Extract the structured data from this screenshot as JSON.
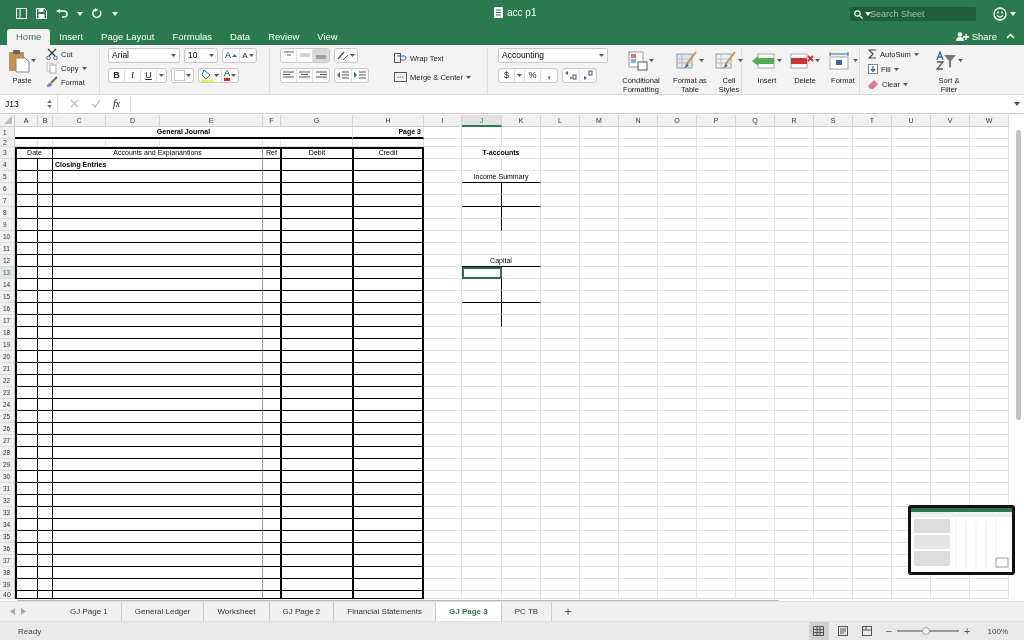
{
  "title_bar": {
    "title": "acc p1",
    "search": {
      "placeholder": "Search Sheet"
    }
  },
  "ribbon_tabs": [
    {
      "label": "Home",
      "selected": true
    },
    {
      "label": "Insert",
      "selected": false
    },
    {
      "label": "Page Layout",
      "selected": false
    },
    {
      "label": "Formulas",
      "selected": false
    },
    {
      "label": "Data",
      "selected": false
    },
    {
      "label": "Review",
      "selected": false
    },
    {
      "label": "View",
      "selected": false
    }
  ],
  "share": "Share",
  "ribbon": {
    "clipboard": {
      "paste": "Paste",
      "cut": "Cut",
      "copy": "Copy",
      "format": "Format"
    },
    "font": {
      "name": "Arial",
      "size": "10",
      "grow": "A",
      "shrink": "A",
      "bold": "B",
      "italic": "I",
      "underline": "U",
      "font_color": "A"
    },
    "alignment": {
      "wrap_text": "Wrap Text",
      "merge": "Merge & Center"
    },
    "number": {
      "format": "Accounting",
      "currency": "$",
      "percent": "%",
      "comma": ","
    },
    "styles": [
      "Conditional Formatting",
      "Format as Table",
      "Cell Styles"
    ],
    "cells": [
      "Insert",
      "Delete",
      "Format"
    ],
    "editing": {
      "autosum": "AutoSum",
      "fill": "Fill",
      "clear": "Clear",
      "sort": "Sort & Filter"
    }
  },
  "formula_bar": {
    "name_box": "J13",
    "fx": "fx"
  },
  "sheet": {
    "columns": [
      {
        "label": "A",
        "selected": false
      },
      {
        "label": "B",
        "selected": false
      },
      {
        "label": "C",
        "selected": false
      },
      {
        "label": "D",
        "selected": false
      },
      {
        "label": "E",
        "selected": false
      },
      {
        "label": "F",
        "selected": false
      },
      {
        "label": "G",
        "selected": false
      },
      {
        "label": "H",
        "selected": false
      },
      {
        "label": "I",
        "selected": false
      },
      {
        "label": "J",
        "selected": true
      },
      {
        "label": "K",
        "selected": false
      },
      {
        "label": "L",
        "selected": false
      },
      {
        "label": "M",
        "selected": false
      },
      {
        "label": "N",
        "selected": false
      },
      {
        "label": "O",
        "selected": false
      },
      {
        "label": "P",
        "selected": false
      },
      {
        "label": "Q",
        "selected": false
      },
      {
        "label": "R",
        "selected": false
      },
      {
        "label": "S",
        "selected": false
      },
      {
        "label": "T",
        "selected": false
      },
      {
        "label": "U",
        "selected": false
      },
      {
        "label": "V",
        "selected": false
      },
      {
        "label": "W",
        "selected": false
      }
    ],
    "rows": [
      {
        "label": "1",
        "selected": false
      },
      {
        "label": "2",
        "selected": false
      },
      {
        "label": "3",
        "selected": false
      },
      {
        "label": "4",
        "selected": false
      },
      {
        "label": "5",
        "selected": false
      },
      {
        "label": "6",
        "selected": false
      },
      {
        "label": "7",
        "selected": false
      },
      {
        "label": "8",
        "selected": false
      },
      {
        "label": "9",
        "selected": false
      },
      {
        "label": "10",
        "selected": false
      },
      {
        "label": "11",
        "selected": false
      },
      {
        "label": "12",
        "selected": false
      },
      {
        "label": "13",
        "selected": true
      },
      {
        "label": "14",
        "selected": false
      },
      {
        "label": "15",
        "selected": false
      },
      {
        "label": "16",
        "selected": false
      },
      {
        "label": "17",
        "selected": false
      },
      {
        "label": "18",
        "selected": false
      },
      {
        "label": "19",
        "selected": false
      },
      {
        "label": "20",
        "selected": false
      },
      {
        "label": "21",
        "selected": false
      },
      {
        "label": "22",
        "selected": false
      },
      {
        "label": "23",
        "selected": false
      },
      {
        "label": "24",
        "selected": false
      },
      {
        "label": "25",
        "selected": false
      },
      {
        "label": "26",
        "selected": false
      },
      {
        "label": "27",
        "selected": false
      },
      {
        "label": "28",
        "selected": false
      },
      {
        "label": "29",
        "selected": false
      },
      {
        "label": "30",
        "selected": false
      },
      {
        "label": "31",
        "selected": false
      },
      {
        "label": "32",
        "selected": false
      },
      {
        "label": "33",
        "selected": false
      },
      {
        "label": "34",
        "selected": false
      },
      {
        "label": "35",
        "selected": false
      },
      {
        "label": "36",
        "selected": false
      },
      {
        "label": "37",
        "selected": false
      },
      {
        "label": "38",
        "selected": false
      },
      {
        "label": "39",
        "selected": false
      },
      {
        "label": "40",
        "selected": false
      }
    ],
    "journal": {
      "title": "General Journal",
      "page": "Page 3",
      "headers": [
        "Date",
        "Accounts and Explanantions",
        "Ref",
        "Debit",
        "Credit"
      ],
      "entries": [
        "Closing Entries"
      ]
    },
    "t_accounts": {
      "title": "T-accounts",
      "accounts": [
        {
          "name": "Income Summary"
        },
        {
          "name": "Capital"
        }
      ]
    }
  },
  "sheet_tabs": [
    {
      "label": "GJ Page 1",
      "selected": false
    },
    {
      "label": "General Ledger",
      "selected": false
    },
    {
      "label": "Worksheet",
      "selected": false
    },
    {
      "label": "GJ Page 2",
      "selected": false
    },
    {
      "label": "Financial Statements",
      "selected": false
    },
    {
      "label": "GJ Page 3",
      "selected": true
    },
    {
      "label": "PC TB",
      "selected": false
    }
  ],
  "add_sheet": "+",
  "status_bar": {
    "status": "Ready",
    "zoom": {
      "minus": "−",
      "plus": "+",
      "level": 0.47,
      "reading": "100%"
    }
  }
}
